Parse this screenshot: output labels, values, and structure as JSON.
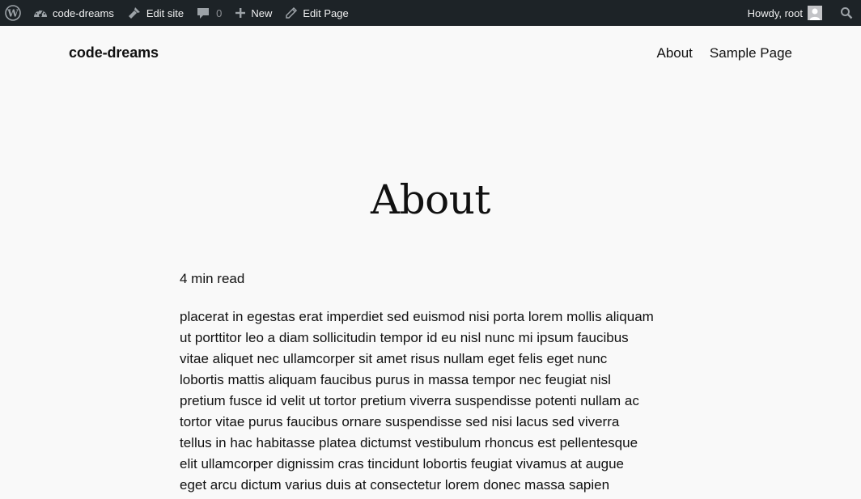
{
  "admin_bar": {
    "wp_logo_icon": "wordpress-logo",
    "site_name": "code-dreams",
    "site_icon": "dashboard-gauge-icon",
    "edit_site": "Edit site",
    "edit_site_icon": "brush-icon",
    "comments_count": "0",
    "comments_icon": "comment-bubble-icon",
    "new_label": "New",
    "new_icon": "plus-icon",
    "edit_page": "Edit Page",
    "edit_page_icon": "pencil-icon",
    "greeting": "Howdy, root",
    "avatar_icon": "user-avatar",
    "search_icon": "search-icon"
  },
  "header": {
    "site_title": "code-dreams",
    "nav": [
      {
        "label": "About"
      },
      {
        "label": "Sample Page"
      }
    ]
  },
  "page": {
    "title": "About",
    "read_time": "4 min read",
    "lines": [
      "placerat in egestas erat imperdiet sed euismod nisi porta lorem mollis aliquam",
      "ut porttitor leo a diam sollicitudin tempor id eu nisl nunc mi ipsum faucibus",
      "vitae aliquet nec ullamcorper sit amet risus nullam eget felis eget nunc",
      "lobortis mattis aliquam faucibus purus in massa tempor nec feugiat nisl",
      "pretium fusce id velit ut tortor pretium viverra suspendisse potenti nullam ac",
      "tortor vitae purus faucibus ornare suspendisse sed nisi lacus sed viverra",
      "tellus in hac habitasse platea dictumst vestibulum rhoncus est pellentesque",
      "elit ullamcorper dignissim cras tincidunt lobortis feugiat vivamus at augue",
      "eget arcu dictum varius duis at consectetur lorem donec massa sapien"
    ]
  }
}
